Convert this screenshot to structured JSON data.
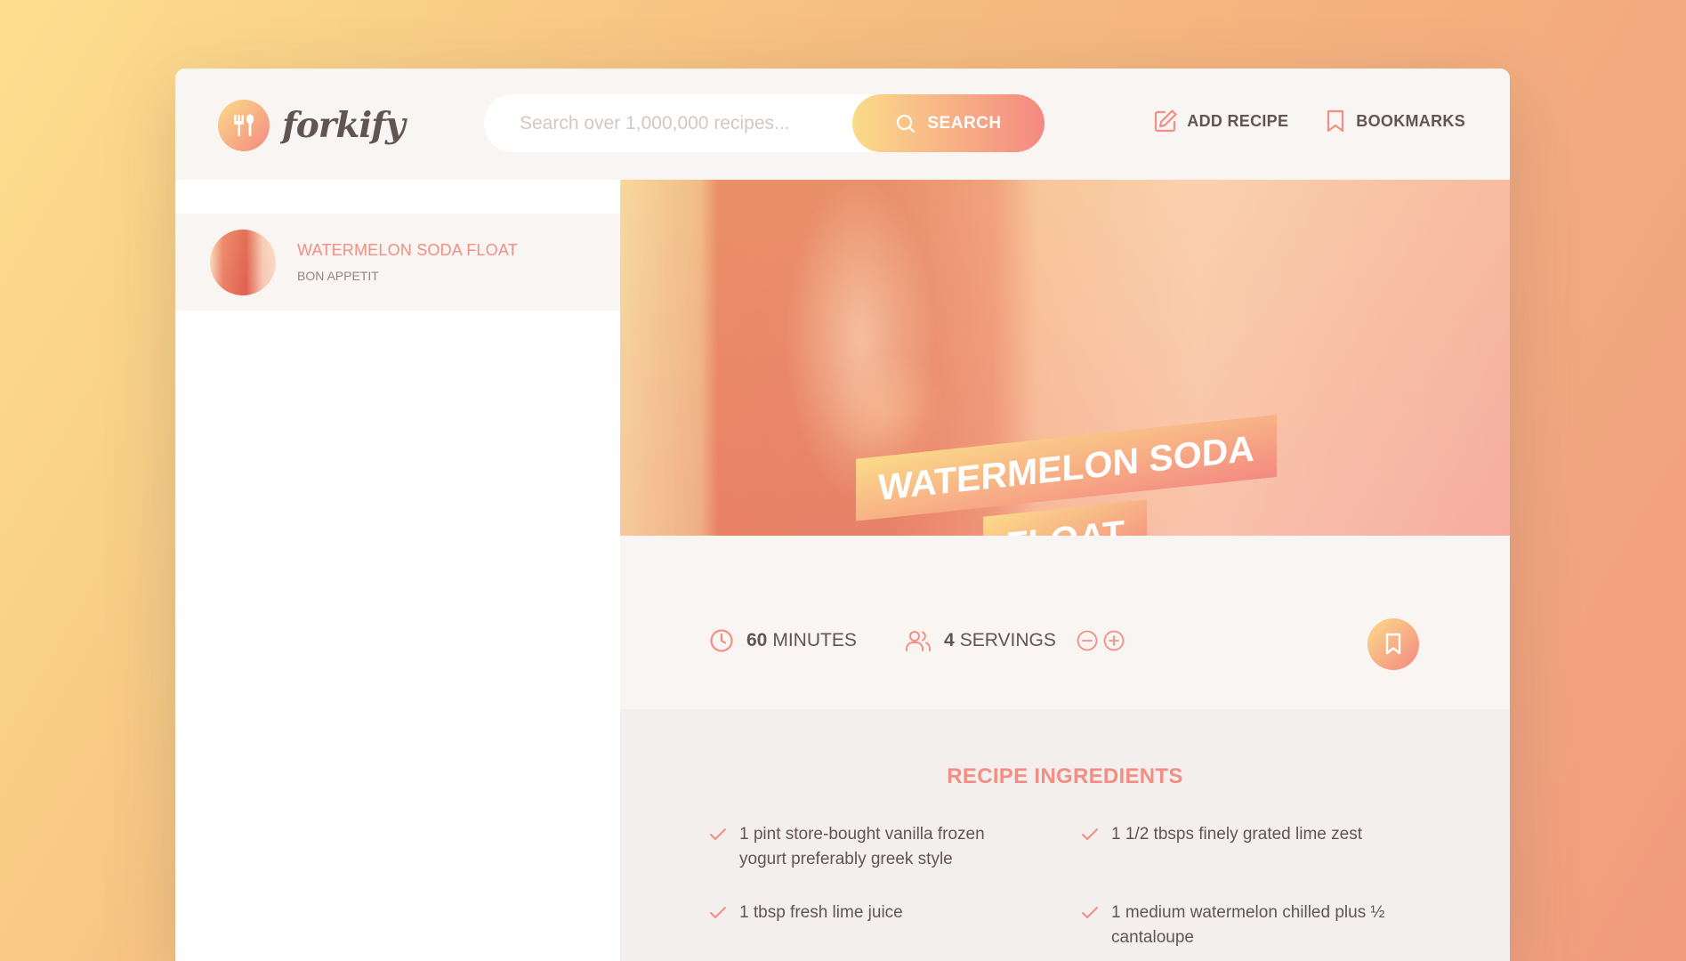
{
  "header": {
    "logo_text": "forkify",
    "search_placeholder": "Search over 1,000,000 recipes...",
    "search_button": "SEARCH",
    "nav": {
      "add_recipe": "ADD RECIPE",
      "bookmarks": "BOOKMARKS"
    }
  },
  "results": [
    {
      "title": "WATERMELON SODA FLOAT",
      "publisher": "BON APPETIT"
    }
  ],
  "recipe": {
    "title": "WATERMELON SODA FLOAT",
    "cooking_time": "60",
    "cooking_time_unit": "MINUTES",
    "servings": "4",
    "servings_unit": "SERVINGS",
    "ingredients_heading": "RECIPE INGREDIENTS",
    "ingredients": [
      "1 pint store-bought vanilla frozen yogurt preferably greek style",
      "1 1/2 tbsps finely grated lime zest",
      "1 tbsp fresh lime juice",
      "1 medium watermelon chilled plus ½ cantaloupe"
    ]
  },
  "colors": {
    "accent_start": "#fbdb89",
    "accent_end": "#f48982",
    "text": "#615551"
  },
  "icons": [
    "fork-spoon-icon",
    "search-icon",
    "edit-icon",
    "bookmark-icon",
    "clock-icon",
    "users-icon",
    "minus-circle-icon",
    "plus-circle-icon",
    "check-icon"
  ]
}
